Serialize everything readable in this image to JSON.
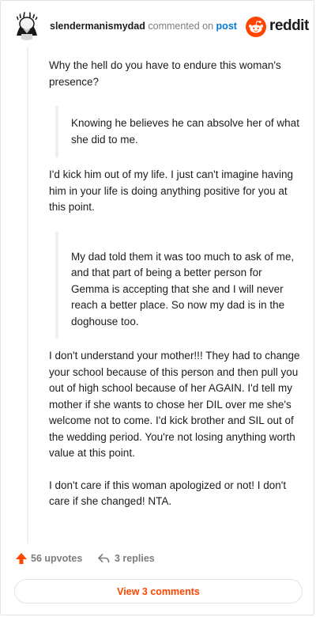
{
  "header": {
    "username": "slendermanismydad",
    "action_text": "commented on",
    "post_link": "post",
    "brand": "reddit"
  },
  "comment": {
    "p1": "Why the hell do you have to endure this woman's presence?",
    "quote1": "Knowing he believes he can absolve her of what she did to me.",
    "p2": "I'd kick him out of my life. I just can't imagine having him in your life is doing anything positive for you at this point.",
    "quote2": "My dad told them it was too much to ask of me, and that part of being a better person for Gemma is accepting that she and I will never reach a better place. So now my dad is in the doghouse too.",
    "p3": "I don't understand your mother!!! They had to change your school because of this person and then pull you out of high school because of her AGAIN. I'd tell my mother if she wants to chose her DIL over me she's welcome not to come. I'd kick brother and SIL out of the wedding period. You're not losing anything worth value at this point.",
    "p4": "I don't care if this woman apologized or not! I don't care if she changed! NTA."
  },
  "footer": {
    "upvotes": "56 upvotes",
    "replies": "3 replies",
    "view_comments": "View 3 comments"
  },
  "colors": {
    "brand_orange": "#ff4500",
    "link_blue": "#0079d3",
    "muted_gray": "#7c7c7c"
  },
  "icons": [
    "avatar",
    "reddit-logo-icon",
    "upvote-arrow-icon",
    "reply-arrow-icon"
  ]
}
